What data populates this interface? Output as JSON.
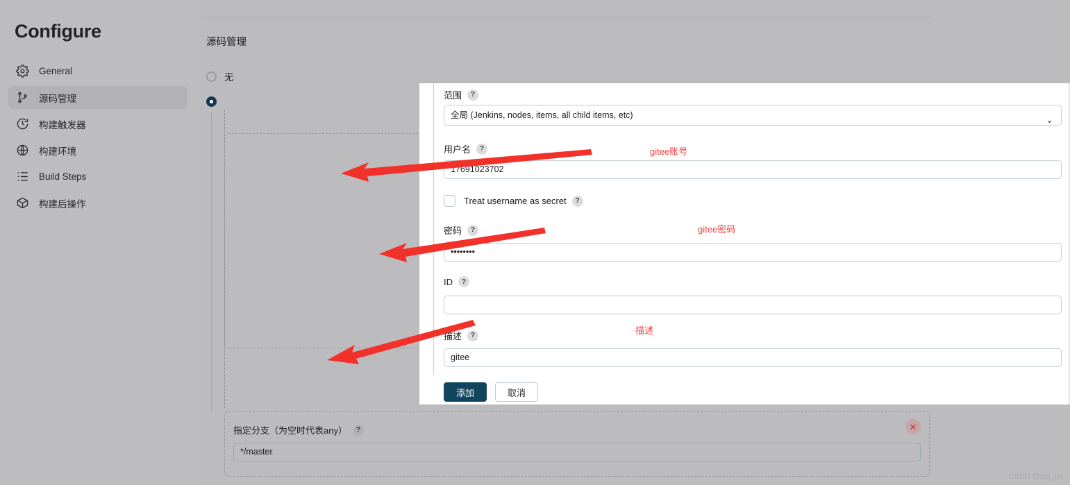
{
  "sidebar": {
    "title": "Configure",
    "items": [
      {
        "label": "General",
        "icon": "gear-icon",
        "active": false
      },
      {
        "label": "源码管理",
        "icon": "git-branch-icon",
        "active": true
      },
      {
        "label": "构建触发器",
        "icon": "clock-icon",
        "active": false
      },
      {
        "label": "构建环境",
        "icon": "globe-icon",
        "active": false
      },
      {
        "label": "Build Steps",
        "icon": "list-icon",
        "active": false
      },
      {
        "label": "构建后操作",
        "icon": "package-icon",
        "active": false
      }
    ]
  },
  "main": {
    "section_title": "源码管理",
    "radios": [
      {
        "label": "无",
        "checked": false
      },
      {
        "label": "",
        "checked": true
      }
    ]
  },
  "branch_panel": {
    "label": "指定分支（为空时代表any）",
    "help": "?",
    "value": "*/master",
    "remove_label": "✕"
  },
  "ghost_panel": {
    "remove_label": "✕",
    "chevron": "⌄"
  },
  "modal": {
    "scope": {
      "label": "范围",
      "help": "?",
      "value": "全局 (Jenkins, nodes, items, all child items, etc)",
      "chevron": "⌄"
    },
    "username": {
      "label": "用户名",
      "help": "?",
      "value": "17691023702"
    },
    "treat_secret": {
      "label": "Treat username as secret",
      "help": "?",
      "checked": false
    },
    "password": {
      "label": "密码",
      "help": "?",
      "value": "••••••••"
    },
    "id": {
      "label": "ID",
      "help": "?",
      "value": ""
    },
    "description": {
      "label": "描述",
      "help": "?",
      "value": "gitee"
    },
    "buttons": {
      "add": "添加",
      "cancel": "取消"
    },
    "scrollbar": {
      "up": "▲",
      "down": "▼"
    }
  },
  "annotations": [
    {
      "text": "gitee账号"
    },
    {
      "text": "gitee密码"
    },
    {
      "text": "描述"
    }
  ],
  "watermark": "CSDN @cm_pq",
  "colors": {
    "accent": "#12465f",
    "annotation": "#fb3a35",
    "remove": "#c0392b",
    "page_bg": "#bcbcbe"
  }
}
